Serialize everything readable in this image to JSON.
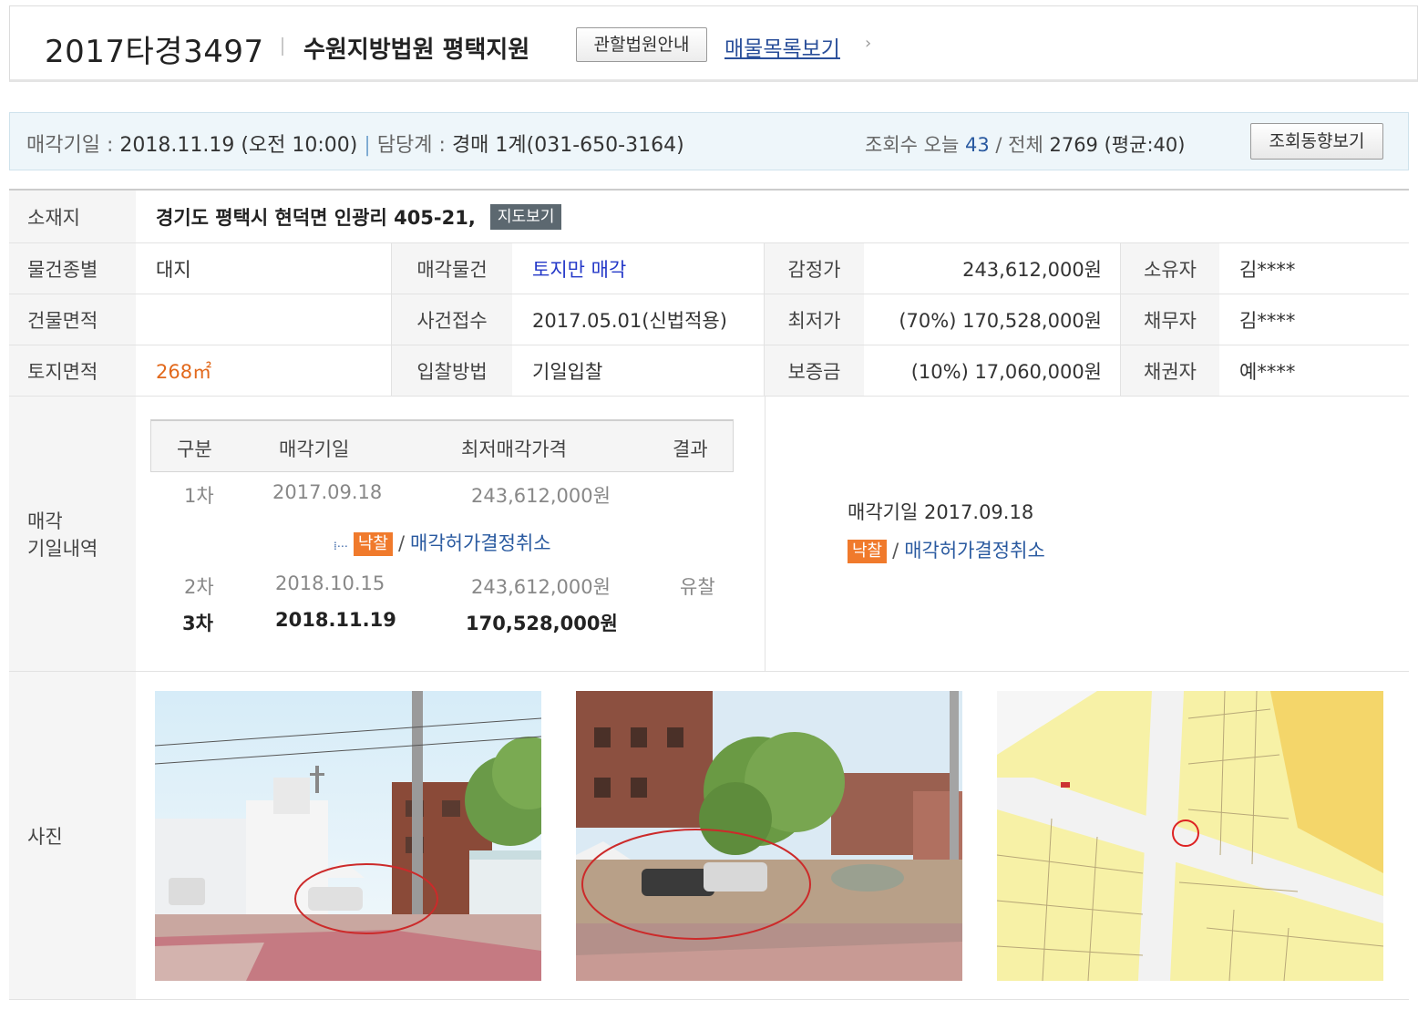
{
  "header": {
    "case_no": "2017타경3497",
    "court": "수원지방법원 평택지원",
    "court_guide_btn": "관할법원안내",
    "list_link": "매물목록보기",
    "chevron": "›"
  },
  "infobar": {
    "sale_date_label": "매각기일 :",
    "sale_date_value": "2018.11.19 (오전 10:00)",
    "sep": "|",
    "dept_label": "담당계 :",
    "dept_value": "경매 1계(031-650-3164)",
    "views_label": "조회수 오늘",
    "views_today": "43",
    "views_total_label": "/ 전체",
    "views_total": "2769",
    "views_avg": "(평균:40)",
    "trend_btn": "조회동향보기"
  },
  "table": {
    "location_label": "소재지",
    "location_value": "경기도 평택시 현덕면 인광리 405-21,",
    "map_btn": "지도보기",
    "r1": {
      "c1_label": "물건종별",
      "c1_value": "대지",
      "c2_label": "매각물건",
      "c2_value": "토지만 매각",
      "c3_label": "감정가",
      "c3_value": "243,612,000원",
      "c4_label": "소유자",
      "c4_value": "김****"
    },
    "r2": {
      "c1_label": "건물면적",
      "c1_value": "",
      "c2_label": "사건접수",
      "c2_value": "2017.05.01(신법적용)",
      "c3_label": "최저가",
      "c3_value": "(70%) 170,528,000원",
      "c4_label": "채무자",
      "c4_value": "김****"
    },
    "r3": {
      "c1_label": "토지면적",
      "c1_value": "268㎡",
      "c2_label": "입찰방법",
      "c2_value": "기일입찰",
      "c3_label": "보증금",
      "c3_value": "(10%) 17,060,000원",
      "c4_label": "채권자",
      "c4_value": "예****"
    }
  },
  "history": {
    "label_line1": "매각",
    "label_line2": "기일내역",
    "headers": [
      "구분",
      "매각기일",
      "최저매각가격",
      "결과"
    ],
    "rows": [
      {
        "round": "1차",
        "date": "2017.09.18",
        "price": "243,612,000원",
        "result": ""
      },
      {
        "round": "2차",
        "date": "2018.10.15",
        "price": "243,612,000원",
        "result": "유찰"
      },
      {
        "round": "3차",
        "date": "2018.11.19",
        "price": "170,528,000원",
        "result": ""
      }
    ],
    "sub_badge": "낙찰",
    "sub_slash": "/",
    "sub_text": "매각허가결정취소",
    "side_date": "매각기일 2017.09.18",
    "side_badge": "낙찰",
    "side_slash": "/",
    "side_text": "매각허가결정취소"
  },
  "photos": {
    "label": "사진"
  },
  "colors": {
    "accent_blue": "#2a5aa0",
    "badge_orange": "#f07a2c",
    "area_orange": "#e2691c",
    "link_blue": "#2438c8"
  }
}
